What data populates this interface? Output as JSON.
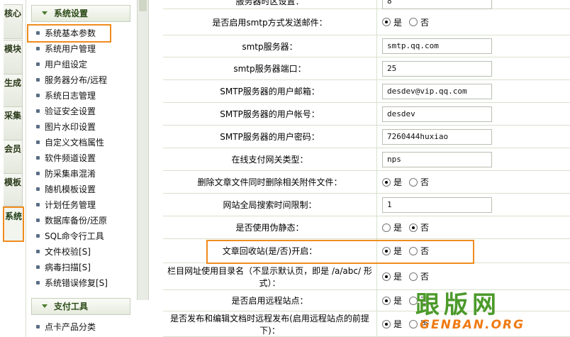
{
  "vertical_tabs": [
    {
      "label": "核心",
      "active": false
    },
    {
      "label": "模块",
      "active": false
    },
    {
      "label": "生成",
      "active": false
    },
    {
      "label": "采集",
      "active": false
    },
    {
      "label": "会员",
      "active": false
    },
    {
      "label": "模板",
      "active": false
    },
    {
      "label": "系统",
      "active": true
    }
  ],
  "menu": {
    "system_group": {
      "title": "系统设置",
      "items": [
        "系统基本参数",
        "系统用户管理",
        "用户组设定",
        "服务器分布/远程",
        "系统日志管理",
        "验证安全设置",
        "图片水印设置",
        "自定义文档属性",
        "软件频道设置",
        "防采集串混淆",
        "随机模板设置",
        "计划任务管理",
        "数据库备份/还原",
        "SQL命令行工具",
        "文件校验[S]",
        "病毒扫描[S]",
        "系统错误修复[S]"
      ],
      "highlighted_item": "系统基本参数"
    },
    "pay_group": {
      "title": "支付工具",
      "items": [
        "点卡产品分类"
      ]
    }
  },
  "settings": {
    "top_partial": {
      "label": "服务器时区设置：",
      "value": "8"
    },
    "rows": [
      {
        "label": "是否启用smtp方式发送邮件：",
        "type": "radio",
        "yes": "是",
        "no": "否",
        "selected": "yes"
      },
      {
        "label": "smtp服务器：",
        "type": "text",
        "value": "smtp.qq.com"
      },
      {
        "label": "smtp服务器端口：",
        "type": "text",
        "value": "25"
      },
      {
        "label": "SMTP服务器的用户邮箱：",
        "type": "text",
        "value": "desdev@vip.qq.com"
      },
      {
        "label": "SMTP服务器的用户帐号：",
        "type": "text",
        "value": "desdev"
      },
      {
        "label": "SMTP服务器的用户密码：",
        "type": "text",
        "value": "7260444huxiao"
      },
      {
        "label": "在线支付网关类型：",
        "type": "text",
        "value": "nps"
      },
      {
        "label": "删除文章文件同时删除相关附件文件：",
        "type": "radio",
        "yes": "是",
        "no": "否",
        "selected": "yes"
      },
      {
        "label": "网站全局搜索时间限制：",
        "type": "text",
        "value": "1"
      },
      {
        "label": "是否使用伪静态：",
        "type": "radio",
        "yes": "是",
        "no": "否",
        "selected": "no"
      },
      {
        "label": "文章回收站(是/否)开启：",
        "type": "radio",
        "yes": "是",
        "no": "否",
        "selected": "yes"
      },
      {
        "label": "栏目网址使用目录名（不显示默认页，即是 /a/abc/ 形式）：",
        "type": "radio",
        "yes": "是",
        "no": "否",
        "selected": "yes"
      },
      {
        "label": "是否启用远程站点：",
        "type": "radio",
        "yes": "是",
        "no": "否",
        "selected": "yes"
      },
      {
        "label": "是否发布和编辑文档时远程发布(启用远程站点的前提下)：",
        "type": "radio",
        "yes": "是",
        "no": "否",
        "selected": "yes"
      }
    ]
  },
  "watermark": {
    "big": "跟版网",
    "small": "GENBAN.ORG"
  },
  "colors": {
    "highlight": "#f08c1e",
    "menu_text": "#2b4a16",
    "bullet": "#5a6e85"
  }
}
